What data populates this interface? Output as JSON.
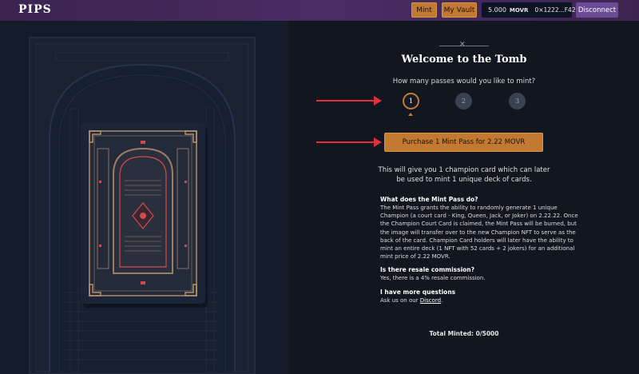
{
  "header": {
    "logo": "PIPS",
    "mint_label": "Mint",
    "vault_label": "My Vault",
    "balance_amount": "5.000",
    "balance_symbol": "MOVR",
    "wallet_address": "0×1222...F423",
    "disconnect_label": "Disconnect"
  },
  "main": {
    "title": "Welcome to the Tomb",
    "question": "How many passes would you like to mint?",
    "quantities": [
      "1",
      "2",
      "3"
    ],
    "selected_quantity": "1",
    "purchase_label": "Purchase 1 Mint Pass for 2.22 MOVR",
    "description": "This will give you 1 champion card which can later be used to mint 1 unique deck of cards.",
    "faq": [
      {
        "question": "What does the Mint Pass do?",
        "answer": "The Mint Pass grants the ability to randomly generate 1 unique Champion (a court card - King, Queen, Jack, or Joker) on 2.22.22. Once the Champion Court Card is claimed, the Mint Pass will be burned, but the image will transfer over to the new Champion NFT to serve as the back of the card. Champion Card holders will later have the ability to mint an entire deck (1 NFT with 52 cards + 2 jokers) for an additional mint price of 2.22 MOVR."
      },
      {
        "question": "Is there resale commission?",
        "answer": "Yes, there is a 4% resale commission."
      },
      {
        "question": "I have more questions",
        "answer_prefix": "Ask us on our ",
        "answer_link": "Discord",
        "answer_suffix": "."
      }
    ],
    "total_minted": "Total Minted: 0/5000"
  },
  "colors": {
    "accent": "#c27a33",
    "topbar": "#4a2c63",
    "background": "#11161f",
    "disconnect": "#6b4b95",
    "arrow": "#e0303a"
  },
  "icons": {
    "close_ornament": "close-icon",
    "card_art": "tomb-card-art"
  }
}
